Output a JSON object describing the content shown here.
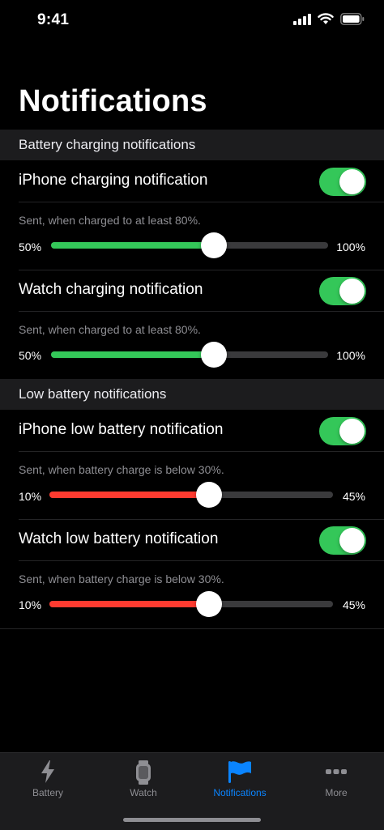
{
  "status_bar": {
    "time": "9:41"
  },
  "title": "Notifications",
  "colors": {
    "toggle_on": "#34c759",
    "charging_fill": "#34c759",
    "low_fill": "#ff3b30",
    "tab_active": "#0a84ff",
    "tab_inactive": "#8e8e93"
  },
  "sections": [
    {
      "header": "Battery charging notifications",
      "items": [
        {
          "label": "iPhone charging notification",
          "enabled": true,
          "description": "Sent, when charged to at least 80%.",
          "min_label": "50%",
          "max_label": "100%",
          "value_fraction": 0.6
        },
        {
          "label": "Watch charging notification",
          "enabled": true,
          "description": "Sent, when charged to at least 80%.",
          "min_label": "50%",
          "max_label": "100%",
          "value_fraction": 0.6
        }
      ]
    },
    {
      "header": "Low battery notifications",
      "items": [
        {
          "label": "iPhone low battery notification",
          "enabled": true,
          "description": "Sent, when battery charge is below 30%.",
          "min_label": "10%",
          "max_label": "45%",
          "value_fraction": 0.57
        },
        {
          "label": "Watch low battery notification",
          "enabled": true,
          "description": "Sent, when battery charge is below 30%.",
          "min_label": "10%",
          "max_label": "45%",
          "value_fraction": 0.57
        }
      ]
    }
  ],
  "tab_bar": {
    "tabs": [
      {
        "label": "Battery",
        "icon": "bolt-icon",
        "active": false
      },
      {
        "label": "Watch",
        "icon": "watch-icon",
        "active": false
      },
      {
        "label": "Notifications",
        "icon": "flag-icon",
        "active": true
      },
      {
        "label": "More",
        "icon": "more-dots-icon",
        "active": false
      }
    ]
  }
}
